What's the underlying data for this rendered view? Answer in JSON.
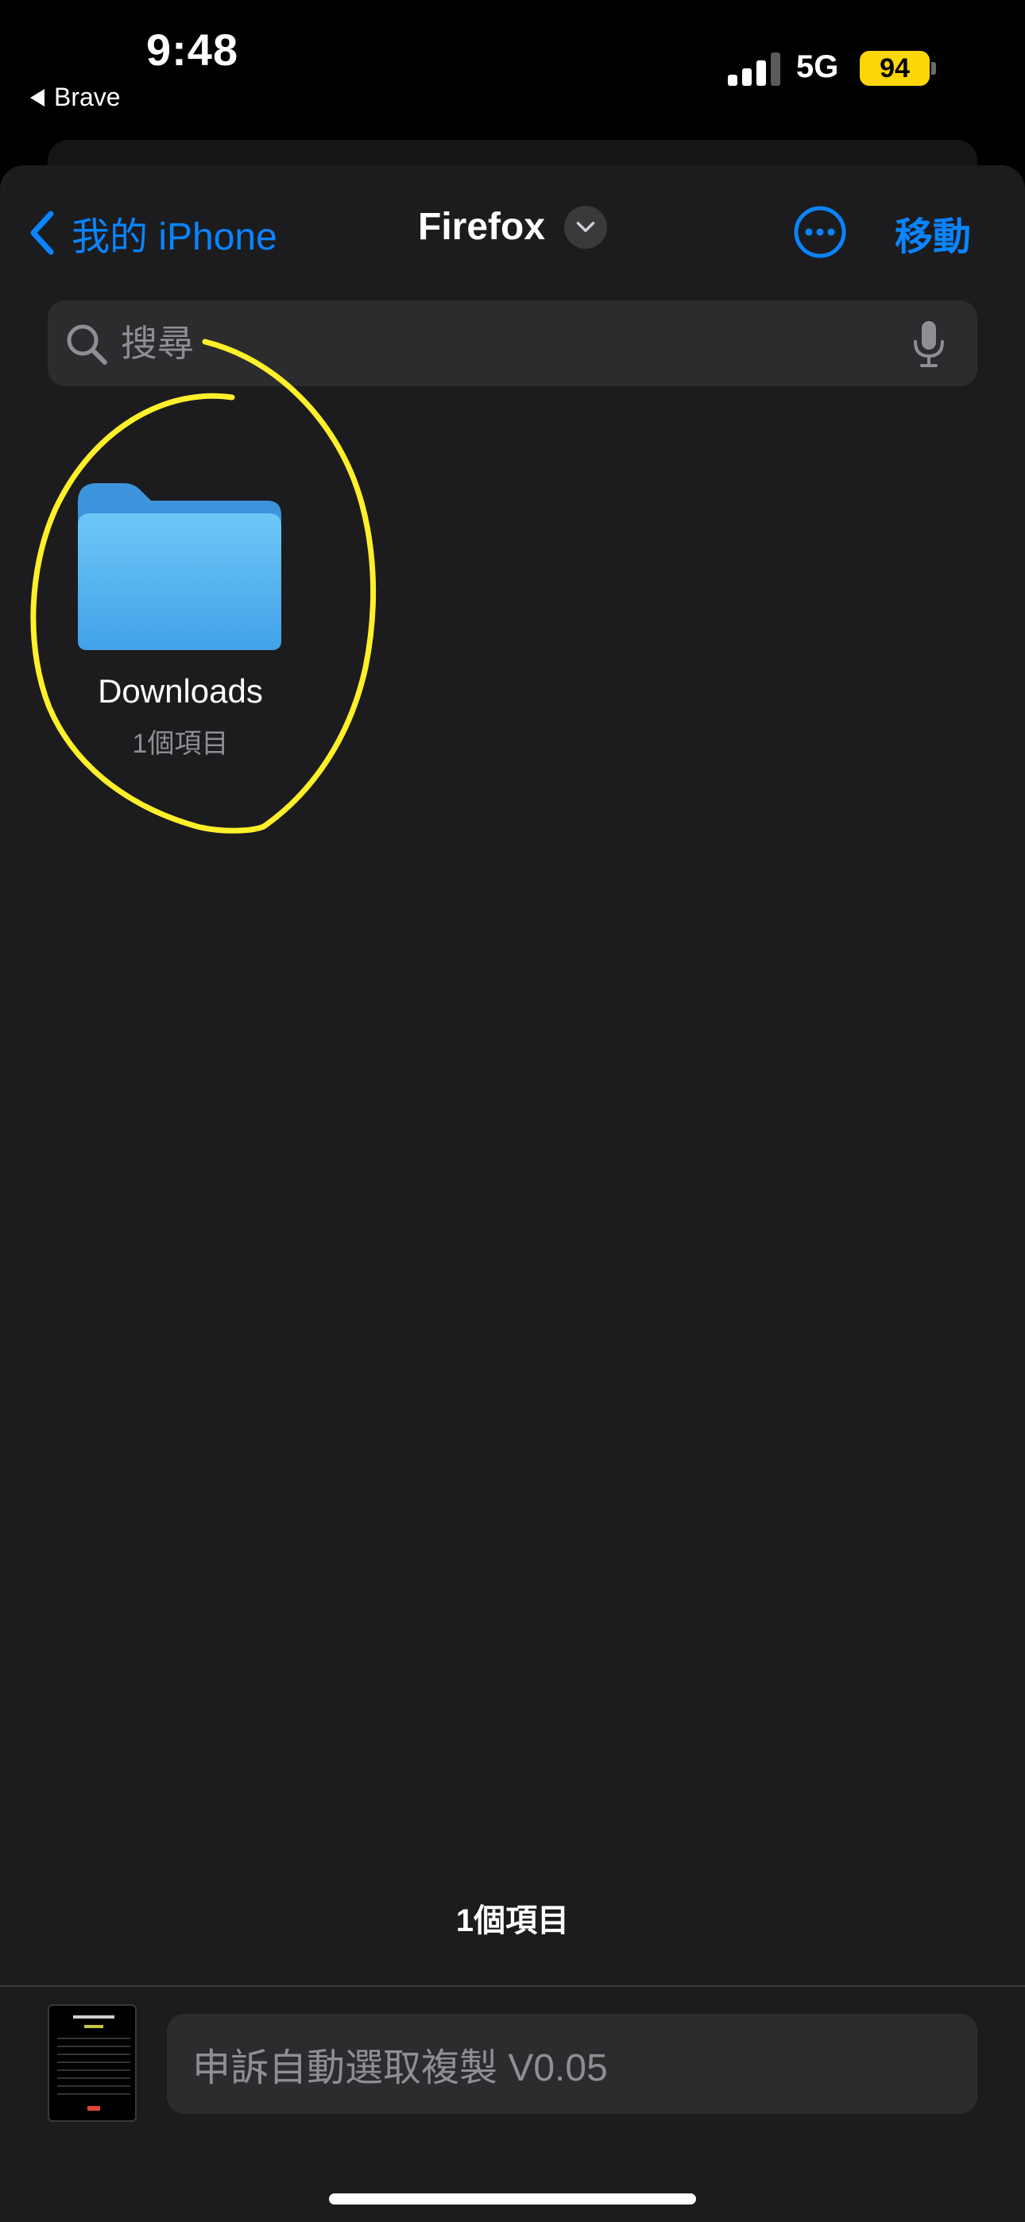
{
  "status_bar": {
    "time": "9:48",
    "back_app": "Brave",
    "network": "5G",
    "battery": "94",
    "battery_color": "#ffd60a"
  },
  "nav": {
    "back_label": "我的 iPhone",
    "title": "Firefox",
    "action_label": "移動",
    "accent_color": "#0a84ff"
  },
  "search": {
    "placeholder": "搜尋"
  },
  "folders": [
    {
      "name": "Downloads",
      "count": "1個項目",
      "icon": "folder-icon"
    }
  ],
  "footer": {
    "item_count": "1個項目",
    "filename_value": "申訴自動選取複製 V0.05"
  },
  "annotation_color": "#fff02a"
}
